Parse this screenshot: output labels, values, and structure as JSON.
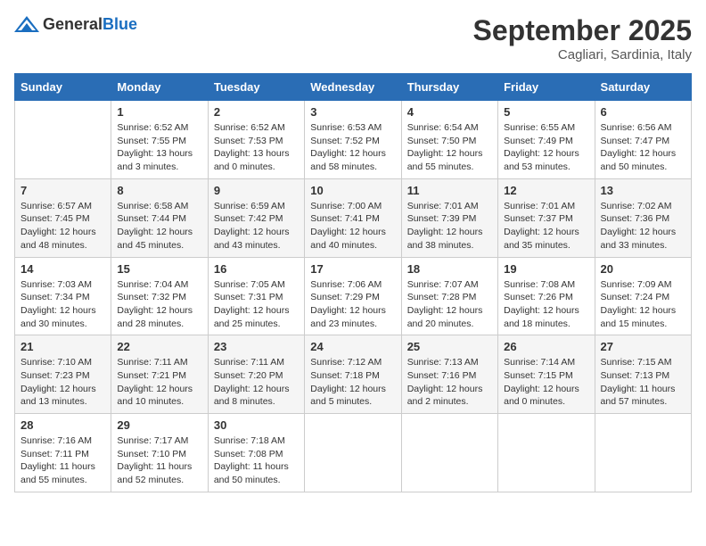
{
  "header": {
    "logo_general": "General",
    "logo_blue": "Blue",
    "month_title": "September 2025",
    "location": "Cagliari, Sardinia, Italy"
  },
  "columns": [
    "Sunday",
    "Monday",
    "Tuesday",
    "Wednesday",
    "Thursday",
    "Friday",
    "Saturday"
  ],
  "weeks": [
    [
      {
        "day": "",
        "info": ""
      },
      {
        "day": "1",
        "info": "Sunrise: 6:52 AM\nSunset: 7:55 PM\nDaylight: 13 hours\nand 3 minutes."
      },
      {
        "day": "2",
        "info": "Sunrise: 6:52 AM\nSunset: 7:53 PM\nDaylight: 13 hours\nand 0 minutes."
      },
      {
        "day": "3",
        "info": "Sunrise: 6:53 AM\nSunset: 7:52 PM\nDaylight: 12 hours\nand 58 minutes."
      },
      {
        "day": "4",
        "info": "Sunrise: 6:54 AM\nSunset: 7:50 PM\nDaylight: 12 hours\nand 55 minutes."
      },
      {
        "day": "5",
        "info": "Sunrise: 6:55 AM\nSunset: 7:49 PM\nDaylight: 12 hours\nand 53 minutes."
      },
      {
        "day": "6",
        "info": "Sunrise: 6:56 AM\nSunset: 7:47 PM\nDaylight: 12 hours\nand 50 minutes."
      }
    ],
    [
      {
        "day": "7",
        "info": "Sunrise: 6:57 AM\nSunset: 7:45 PM\nDaylight: 12 hours\nand 48 minutes."
      },
      {
        "day": "8",
        "info": "Sunrise: 6:58 AM\nSunset: 7:44 PM\nDaylight: 12 hours\nand 45 minutes."
      },
      {
        "day": "9",
        "info": "Sunrise: 6:59 AM\nSunset: 7:42 PM\nDaylight: 12 hours\nand 43 minutes."
      },
      {
        "day": "10",
        "info": "Sunrise: 7:00 AM\nSunset: 7:41 PM\nDaylight: 12 hours\nand 40 minutes."
      },
      {
        "day": "11",
        "info": "Sunrise: 7:01 AM\nSunset: 7:39 PM\nDaylight: 12 hours\nand 38 minutes."
      },
      {
        "day": "12",
        "info": "Sunrise: 7:01 AM\nSunset: 7:37 PM\nDaylight: 12 hours\nand 35 minutes."
      },
      {
        "day": "13",
        "info": "Sunrise: 7:02 AM\nSunset: 7:36 PM\nDaylight: 12 hours\nand 33 minutes."
      }
    ],
    [
      {
        "day": "14",
        "info": "Sunrise: 7:03 AM\nSunset: 7:34 PM\nDaylight: 12 hours\nand 30 minutes."
      },
      {
        "day": "15",
        "info": "Sunrise: 7:04 AM\nSunset: 7:32 PM\nDaylight: 12 hours\nand 28 minutes."
      },
      {
        "day": "16",
        "info": "Sunrise: 7:05 AM\nSunset: 7:31 PM\nDaylight: 12 hours\nand 25 minutes."
      },
      {
        "day": "17",
        "info": "Sunrise: 7:06 AM\nSunset: 7:29 PM\nDaylight: 12 hours\nand 23 minutes."
      },
      {
        "day": "18",
        "info": "Sunrise: 7:07 AM\nSunset: 7:28 PM\nDaylight: 12 hours\nand 20 minutes."
      },
      {
        "day": "19",
        "info": "Sunrise: 7:08 AM\nSunset: 7:26 PM\nDaylight: 12 hours\nand 18 minutes."
      },
      {
        "day": "20",
        "info": "Sunrise: 7:09 AM\nSunset: 7:24 PM\nDaylight: 12 hours\nand 15 minutes."
      }
    ],
    [
      {
        "day": "21",
        "info": "Sunrise: 7:10 AM\nSunset: 7:23 PM\nDaylight: 12 hours\nand 13 minutes."
      },
      {
        "day": "22",
        "info": "Sunrise: 7:11 AM\nSunset: 7:21 PM\nDaylight: 12 hours\nand 10 minutes."
      },
      {
        "day": "23",
        "info": "Sunrise: 7:11 AM\nSunset: 7:20 PM\nDaylight: 12 hours\nand 8 minutes."
      },
      {
        "day": "24",
        "info": "Sunrise: 7:12 AM\nSunset: 7:18 PM\nDaylight: 12 hours\nand 5 minutes."
      },
      {
        "day": "25",
        "info": "Sunrise: 7:13 AM\nSunset: 7:16 PM\nDaylight: 12 hours\nand 2 minutes."
      },
      {
        "day": "26",
        "info": "Sunrise: 7:14 AM\nSunset: 7:15 PM\nDaylight: 12 hours\nand 0 minutes."
      },
      {
        "day": "27",
        "info": "Sunrise: 7:15 AM\nSunset: 7:13 PM\nDaylight: 11 hours\nand 57 minutes."
      }
    ],
    [
      {
        "day": "28",
        "info": "Sunrise: 7:16 AM\nSunset: 7:11 PM\nDaylight: 11 hours\nand 55 minutes."
      },
      {
        "day": "29",
        "info": "Sunrise: 7:17 AM\nSunset: 7:10 PM\nDaylight: 11 hours\nand 52 minutes."
      },
      {
        "day": "30",
        "info": "Sunrise: 7:18 AM\nSunset: 7:08 PM\nDaylight: 11 hours\nand 50 minutes."
      },
      {
        "day": "",
        "info": ""
      },
      {
        "day": "",
        "info": ""
      },
      {
        "day": "",
        "info": ""
      },
      {
        "day": "",
        "info": ""
      }
    ]
  ]
}
